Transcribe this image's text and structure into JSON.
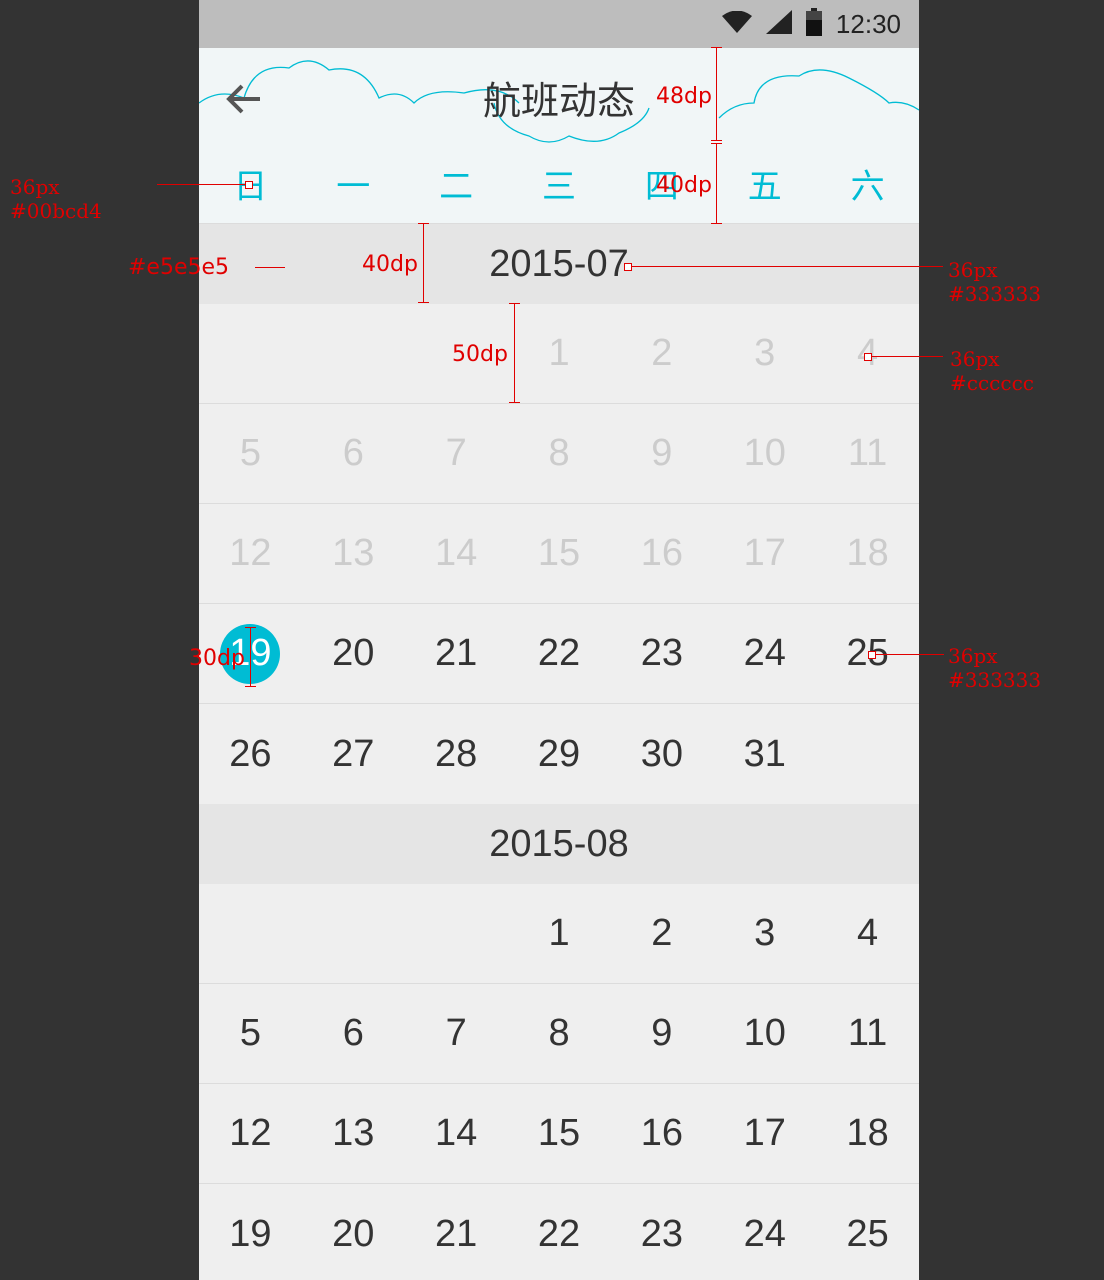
{
  "statusbar": {
    "time": "12:30",
    "icons": [
      "wifi-icon",
      "signal-icon",
      "battery-icon"
    ]
  },
  "appbar": {
    "title": "航班动态",
    "back_icon": "arrow-left-icon"
  },
  "weekdays": [
    "日",
    "一",
    "二",
    "三",
    "四",
    "五",
    "六"
  ],
  "colors": {
    "accent": "#00bcd4",
    "text": "#333333",
    "past_text": "#cccccc",
    "month_bg": "#e5e5e5"
  },
  "months": [
    {
      "label": "2015-07",
      "weeks": [
        [
          "",
          "",
          "",
          "1",
          "2",
          "3",
          "4"
        ],
        [
          "5",
          "6",
          "7",
          "8",
          "9",
          "10",
          "11"
        ],
        [
          "12",
          "13",
          "14",
          "15",
          "16",
          "17",
          "18"
        ],
        [
          "19",
          "20",
          "21",
          "22",
          "23",
          "24",
          "25"
        ],
        [
          "26",
          "27",
          "28",
          "29",
          "30",
          "31",
          ""
        ]
      ],
      "past_days_until": 18,
      "selected_day": "19"
    },
    {
      "label": "2015-08",
      "weeks": [
        [
          "",
          "",
          "",
          "1",
          "2",
          "3",
          "4"
        ],
        [
          "5",
          "6",
          "7",
          "8",
          "9",
          "10",
          "11"
        ],
        [
          "12",
          "13",
          "14",
          "15",
          "16",
          "17",
          "18"
        ],
        [
          "19",
          "20",
          "21",
          "22",
          "23",
          "24",
          "25"
        ]
      ],
      "past_days_until": 0,
      "selected_day": ""
    }
  ],
  "annotations": {
    "weekday_spec": "36px\n#00bcd4",
    "month_bg_spec": "#e5e5e5",
    "month_text_spec": "36px\n#333333",
    "past_day_spec": "36px\n#cccccc",
    "day_spec": "36px\n#333333",
    "appbar_height": "48dp",
    "weekday_height": "40dp",
    "month_height": "40dp",
    "row_height": "50dp",
    "selected_size": "30dp"
  }
}
